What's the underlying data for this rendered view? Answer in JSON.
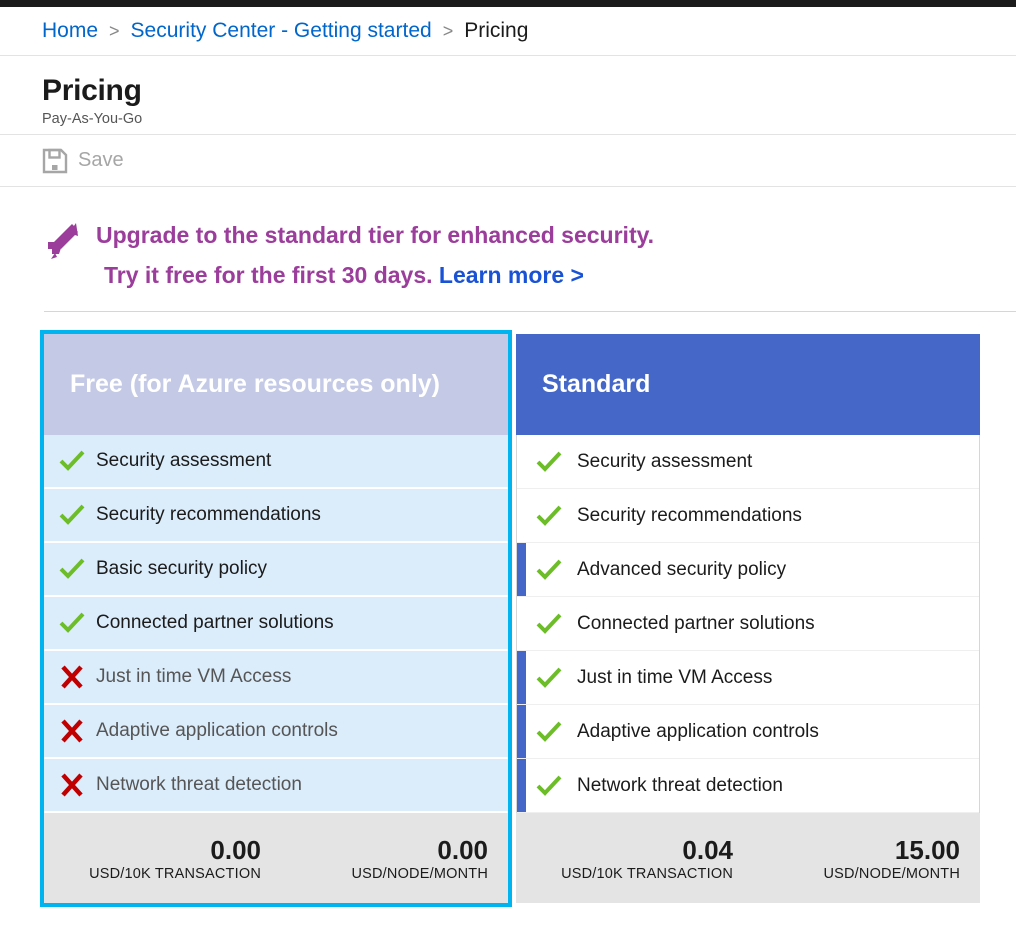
{
  "breadcrumb": {
    "items": [
      {
        "label": "Home",
        "current": false
      },
      {
        "label": "Security Center - Getting started",
        "current": false
      },
      {
        "label": "Pricing",
        "current": true
      }
    ],
    "separator": ">"
  },
  "header": {
    "title": "Pricing",
    "subtitle": "Pay-As-You-Go"
  },
  "command_bar": {
    "save_label": "Save",
    "save_icon": "save-disk-icon",
    "save_disabled": true
  },
  "banner": {
    "icon": "rocket-icon",
    "line1": "Upgrade to the standard tier for enhanced security.",
    "line2": "Try it free for the first 30 days.",
    "link_label": "Learn more >",
    "text_color": "#9b3d9b",
    "link_color": "#1a52d6"
  },
  "colors": {
    "selection_border": "#00b4f0",
    "free_header_bg": "#c4c9e6",
    "standard_header_bg": "#4568c8",
    "free_row_bg": "#dbecfb",
    "footer_bg": "#e4e4e4",
    "check_green": "#6dbd29",
    "cross_red": "#c00000"
  },
  "tiers": [
    {
      "id": "free",
      "name": "Free (for Azure resources only)",
      "selected": true,
      "features": [
        {
          "label": "Security assessment",
          "included": true,
          "highlighted": false
        },
        {
          "label": "Security recommendations",
          "included": true,
          "highlighted": false
        },
        {
          "label": "Basic security policy",
          "included": true,
          "highlighted": false
        },
        {
          "label": "Connected partner solutions",
          "included": true,
          "highlighted": false
        },
        {
          "label": "Just in time VM Access",
          "included": false,
          "highlighted": false
        },
        {
          "label": "Adaptive application controls",
          "included": false,
          "highlighted": false
        },
        {
          "label": "Network threat detection",
          "included": false,
          "highlighted": false
        }
      ],
      "pricing": [
        {
          "value": "0.00",
          "unit": "USD/10K TRANSACTION"
        },
        {
          "value": "0.00",
          "unit": "USD/NODE/MONTH"
        }
      ]
    },
    {
      "id": "standard",
      "name": "Standard",
      "selected": false,
      "features": [
        {
          "label": "Security assessment",
          "included": true,
          "highlighted": false
        },
        {
          "label": "Security recommendations",
          "included": true,
          "highlighted": false
        },
        {
          "label": "Advanced security policy",
          "included": true,
          "highlighted": true
        },
        {
          "label": "Connected partner solutions",
          "included": true,
          "highlighted": false
        },
        {
          "label": "Just in time VM Access",
          "included": true,
          "highlighted": true
        },
        {
          "label": "Adaptive application controls",
          "included": true,
          "highlighted": true
        },
        {
          "label": "Network threat detection",
          "included": true,
          "highlighted": true
        }
      ],
      "pricing": [
        {
          "value": "0.04",
          "unit": "USD/10K TRANSACTION"
        },
        {
          "value": "15.00",
          "unit": "USD/NODE/MONTH"
        }
      ]
    }
  ]
}
